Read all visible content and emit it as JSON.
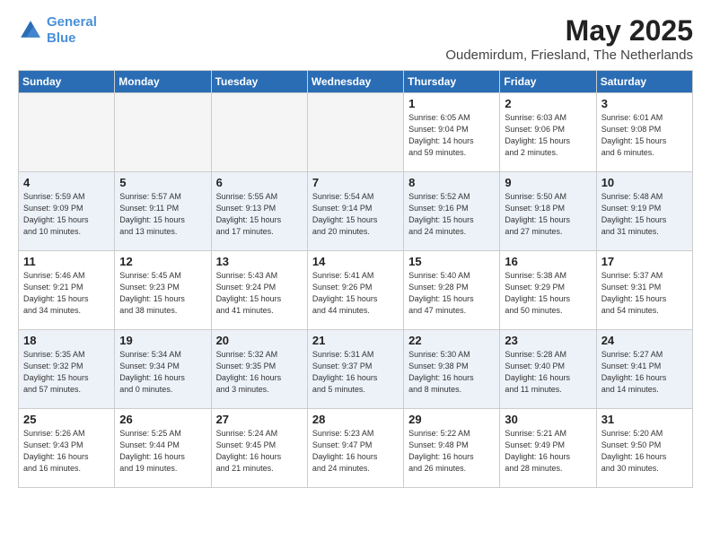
{
  "logo": {
    "line1": "General",
    "line2": "Blue"
  },
  "title": "May 2025",
  "location": "Oudemirdum, Friesland, The Netherlands",
  "headers": [
    "Sunday",
    "Monday",
    "Tuesday",
    "Wednesday",
    "Thursday",
    "Friday",
    "Saturday"
  ],
  "weeks": [
    [
      {
        "day": "",
        "info": ""
      },
      {
        "day": "",
        "info": ""
      },
      {
        "day": "",
        "info": ""
      },
      {
        "day": "",
        "info": ""
      },
      {
        "day": "1",
        "info": "Sunrise: 6:05 AM\nSunset: 9:04 PM\nDaylight: 14 hours\nand 59 minutes."
      },
      {
        "day": "2",
        "info": "Sunrise: 6:03 AM\nSunset: 9:06 PM\nDaylight: 15 hours\nand 2 minutes."
      },
      {
        "day": "3",
        "info": "Sunrise: 6:01 AM\nSunset: 9:08 PM\nDaylight: 15 hours\nand 6 minutes."
      }
    ],
    [
      {
        "day": "4",
        "info": "Sunrise: 5:59 AM\nSunset: 9:09 PM\nDaylight: 15 hours\nand 10 minutes."
      },
      {
        "day": "5",
        "info": "Sunrise: 5:57 AM\nSunset: 9:11 PM\nDaylight: 15 hours\nand 13 minutes."
      },
      {
        "day": "6",
        "info": "Sunrise: 5:55 AM\nSunset: 9:13 PM\nDaylight: 15 hours\nand 17 minutes."
      },
      {
        "day": "7",
        "info": "Sunrise: 5:54 AM\nSunset: 9:14 PM\nDaylight: 15 hours\nand 20 minutes."
      },
      {
        "day": "8",
        "info": "Sunrise: 5:52 AM\nSunset: 9:16 PM\nDaylight: 15 hours\nand 24 minutes."
      },
      {
        "day": "9",
        "info": "Sunrise: 5:50 AM\nSunset: 9:18 PM\nDaylight: 15 hours\nand 27 minutes."
      },
      {
        "day": "10",
        "info": "Sunrise: 5:48 AM\nSunset: 9:19 PM\nDaylight: 15 hours\nand 31 minutes."
      }
    ],
    [
      {
        "day": "11",
        "info": "Sunrise: 5:46 AM\nSunset: 9:21 PM\nDaylight: 15 hours\nand 34 minutes."
      },
      {
        "day": "12",
        "info": "Sunrise: 5:45 AM\nSunset: 9:23 PM\nDaylight: 15 hours\nand 38 minutes."
      },
      {
        "day": "13",
        "info": "Sunrise: 5:43 AM\nSunset: 9:24 PM\nDaylight: 15 hours\nand 41 minutes."
      },
      {
        "day": "14",
        "info": "Sunrise: 5:41 AM\nSunset: 9:26 PM\nDaylight: 15 hours\nand 44 minutes."
      },
      {
        "day": "15",
        "info": "Sunrise: 5:40 AM\nSunset: 9:28 PM\nDaylight: 15 hours\nand 47 minutes."
      },
      {
        "day": "16",
        "info": "Sunrise: 5:38 AM\nSunset: 9:29 PM\nDaylight: 15 hours\nand 50 minutes."
      },
      {
        "day": "17",
        "info": "Sunrise: 5:37 AM\nSunset: 9:31 PM\nDaylight: 15 hours\nand 54 minutes."
      }
    ],
    [
      {
        "day": "18",
        "info": "Sunrise: 5:35 AM\nSunset: 9:32 PM\nDaylight: 15 hours\nand 57 minutes."
      },
      {
        "day": "19",
        "info": "Sunrise: 5:34 AM\nSunset: 9:34 PM\nDaylight: 16 hours\nand 0 minutes."
      },
      {
        "day": "20",
        "info": "Sunrise: 5:32 AM\nSunset: 9:35 PM\nDaylight: 16 hours\nand 3 minutes."
      },
      {
        "day": "21",
        "info": "Sunrise: 5:31 AM\nSunset: 9:37 PM\nDaylight: 16 hours\nand 5 minutes."
      },
      {
        "day": "22",
        "info": "Sunrise: 5:30 AM\nSunset: 9:38 PM\nDaylight: 16 hours\nand 8 minutes."
      },
      {
        "day": "23",
        "info": "Sunrise: 5:28 AM\nSunset: 9:40 PM\nDaylight: 16 hours\nand 11 minutes."
      },
      {
        "day": "24",
        "info": "Sunrise: 5:27 AM\nSunset: 9:41 PM\nDaylight: 16 hours\nand 14 minutes."
      }
    ],
    [
      {
        "day": "25",
        "info": "Sunrise: 5:26 AM\nSunset: 9:43 PM\nDaylight: 16 hours\nand 16 minutes."
      },
      {
        "day": "26",
        "info": "Sunrise: 5:25 AM\nSunset: 9:44 PM\nDaylight: 16 hours\nand 19 minutes."
      },
      {
        "day": "27",
        "info": "Sunrise: 5:24 AM\nSunset: 9:45 PM\nDaylight: 16 hours\nand 21 minutes."
      },
      {
        "day": "28",
        "info": "Sunrise: 5:23 AM\nSunset: 9:47 PM\nDaylight: 16 hours\nand 24 minutes."
      },
      {
        "day": "29",
        "info": "Sunrise: 5:22 AM\nSunset: 9:48 PM\nDaylight: 16 hours\nand 26 minutes."
      },
      {
        "day": "30",
        "info": "Sunrise: 5:21 AM\nSunset: 9:49 PM\nDaylight: 16 hours\nand 28 minutes."
      },
      {
        "day": "31",
        "info": "Sunrise: 5:20 AM\nSunset: 9:50 PM\nDaylight: 16 hours\nand 30 minutes."
      }
    ]
  ]
}
